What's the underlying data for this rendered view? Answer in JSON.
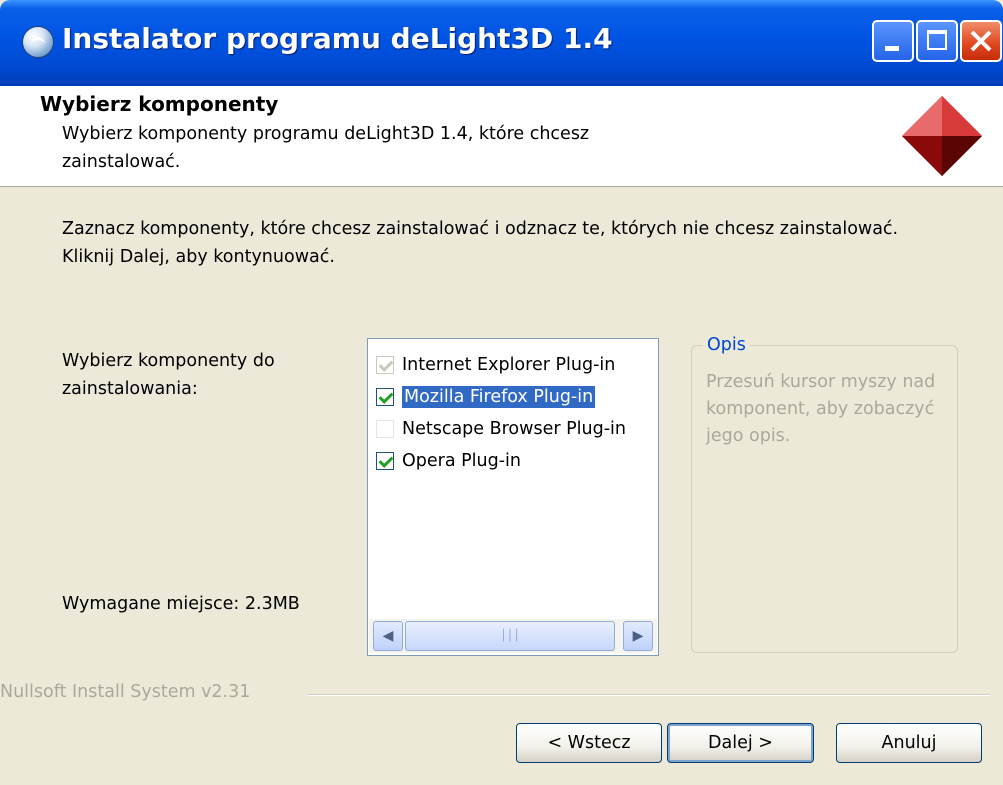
{
  "window": {
    "title": "Instalator programu deLight3D 1.4"
  },
  "header": {
    "title": "Wybierz komponenty",
    "subtitle": "Wybierz komponenty programu deLight3D 1.4, które chcesz zainstalować."
  },
  "intro": "Zaznacz komponenty, które chcesz zainstalować i odznacz te, których nie chcesz zainstalować. Kliknij Dalej, aby kontynuować.",
  "components": {
    "label": "Wybierz komponenty do zainstalowania:",
    "items": [
      {
        "label": "Internet Explorer Plug-in",
        "checked": true,
        "disabled": true,
        "selected": false
      },
      {
        "label": "Mozilla Firefox Plug-in",
        "checked": true,
        "disabled": false,
        "selected": true
      },
      {
        "label": "Netscape Browser Plug-in",
        "checked": false,
        "disabled": false,
        "selected": false
      },
      {
        "label": "Opera Plug-in",
        "checked": true,
        "disabled": false,
        "selected": false
      }
    ]
  },
  "space_required": "Wymagane miejsce: 2.3MB",
  "description": {
    "legend": "Opis",
    "text": "Przesuń kursor myszy nad komponent, aby zobaczyć jego opis."
  },
  "branding": "Nullsoft Install System v2.31",
  "buttons": {
    "back": "< Wstecz",
    "next": "Dalej >",
    "cancel": "Anuluj"
  },
  "colors": {
    "titlebar": "#0054E3",
    "selection": "#316AC5",
    "check": "#21A121",
    "legend": "#0046D5"
  }
}
